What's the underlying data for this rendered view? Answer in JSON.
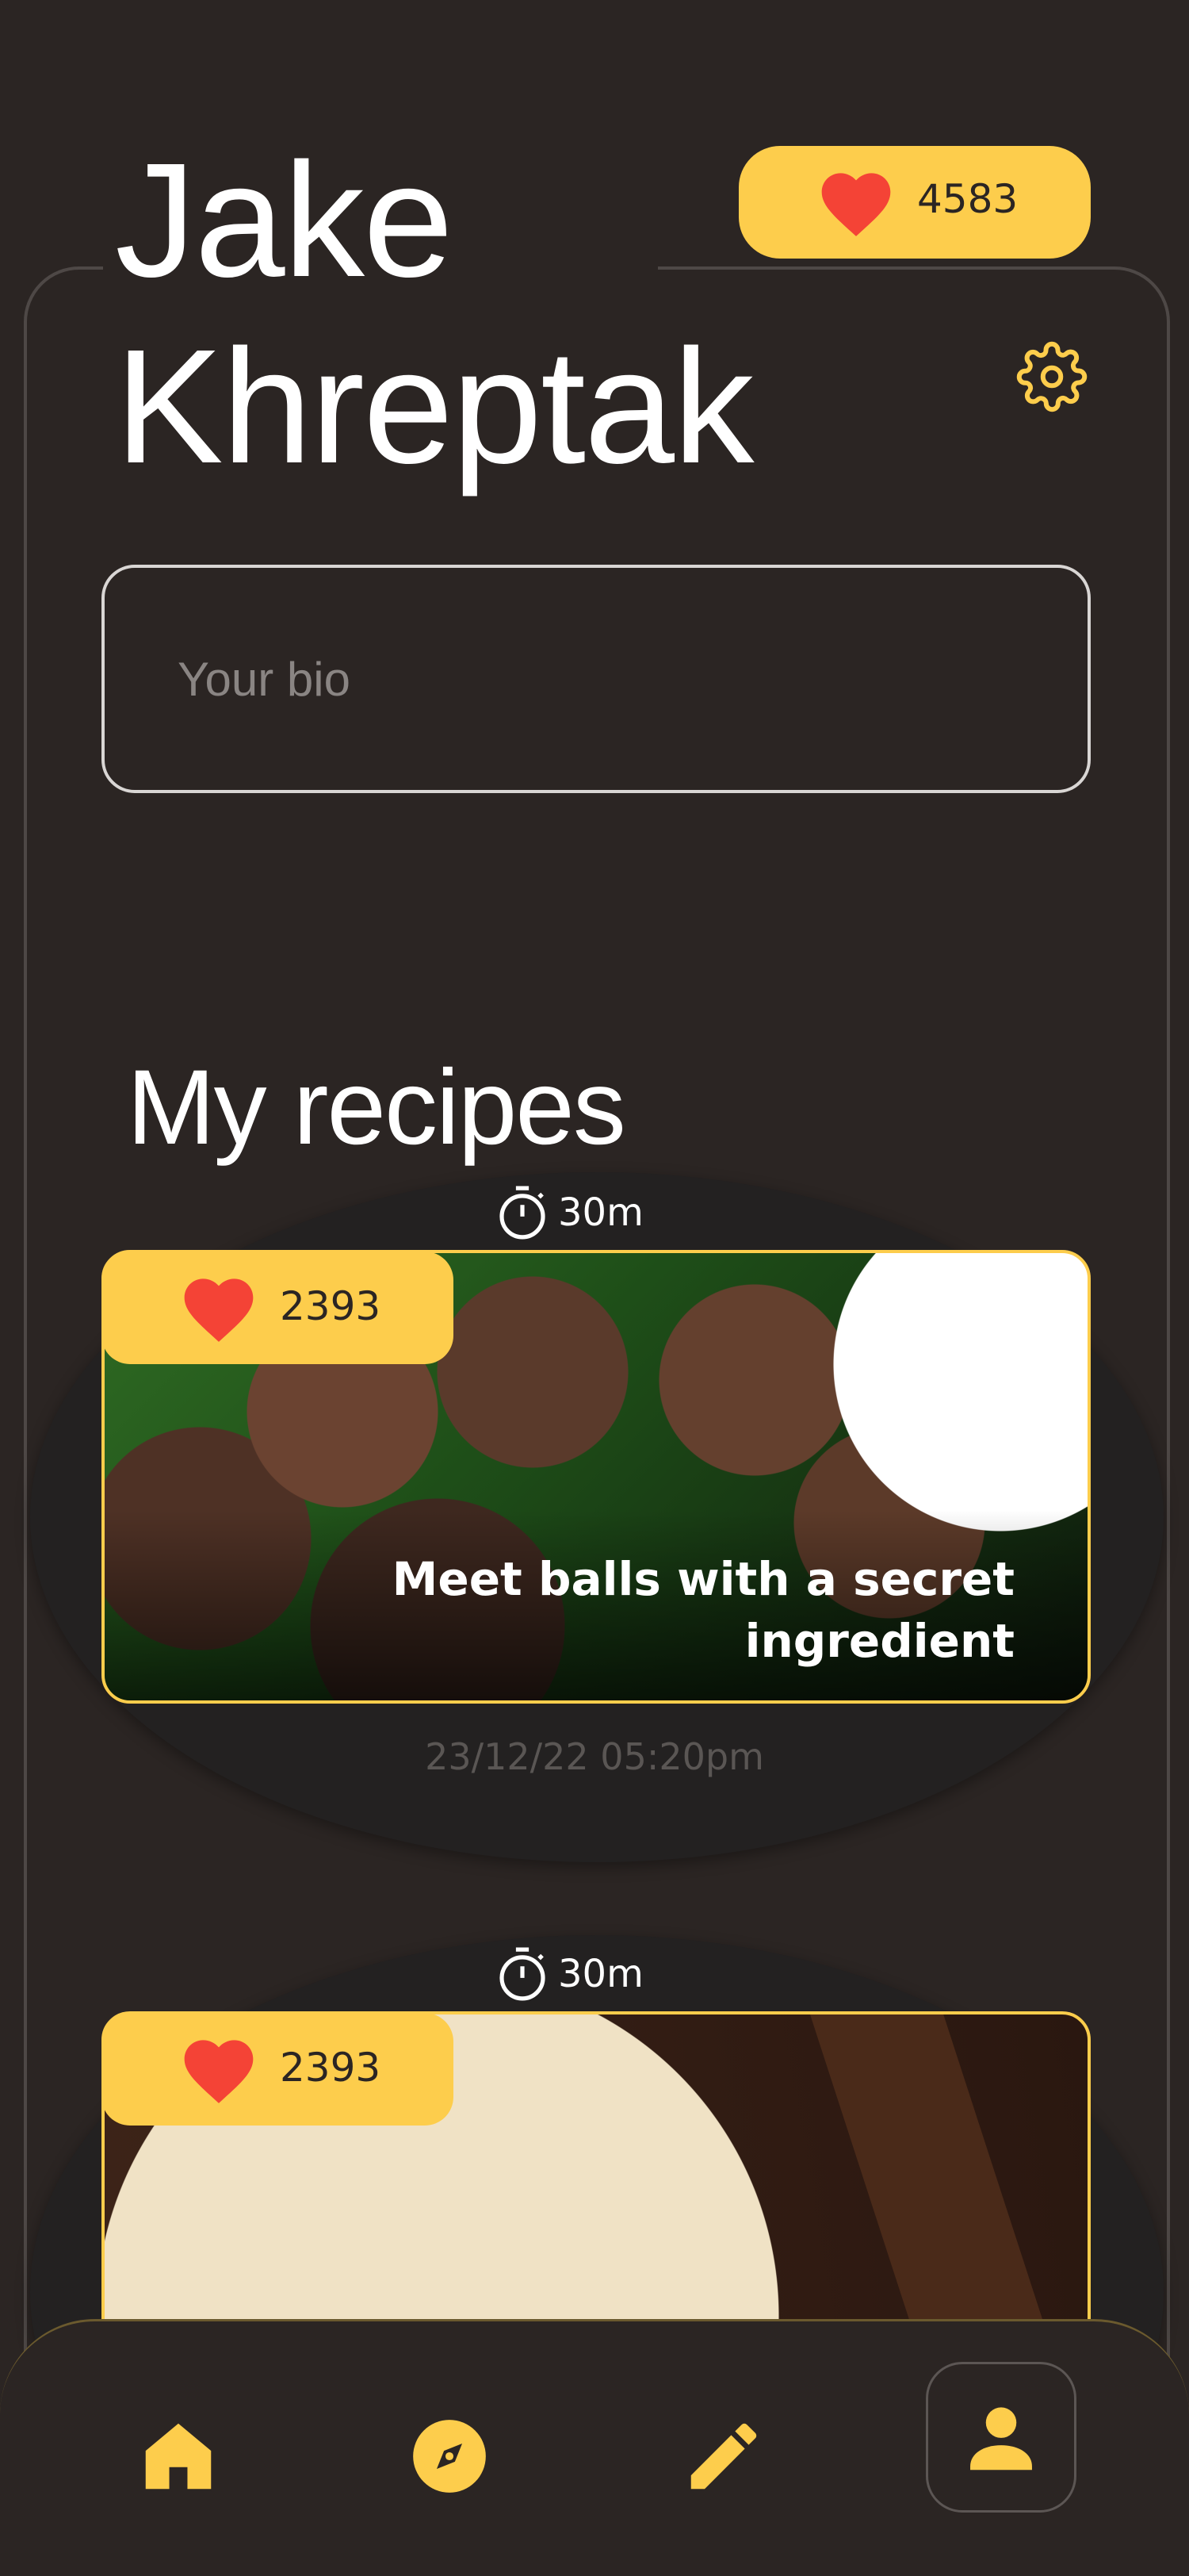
{
  "profile": {
    "name_line1": "Jake",
    "name_line2": "Khreptak",
    "total_likes": "4583",
    "bio_placeholder": "Your bio"
  },
  "section_title": "My recipes",
  "recipes": [
    {
      "time": "30m",
      "likes": "2393",
      "title_line1": "Meet balls with a secret",
      "title_line2": "ingredient",
      "date": "23/12/22 05:20pm"
    },
    {
      "time": "30m",
      "likes": "2393"
    }
  ],
  "nav": {
    "items": [
      "home-icon",
      "compass-icon",
      "pencil-icon",
      "profile-icon"
    ],
    "active": "profile-icon"
  },
  "colors": {
    "accent": "#fdcd4c",
    "heart": "#f44336",
    "background": "#2b2523"
  }
}
